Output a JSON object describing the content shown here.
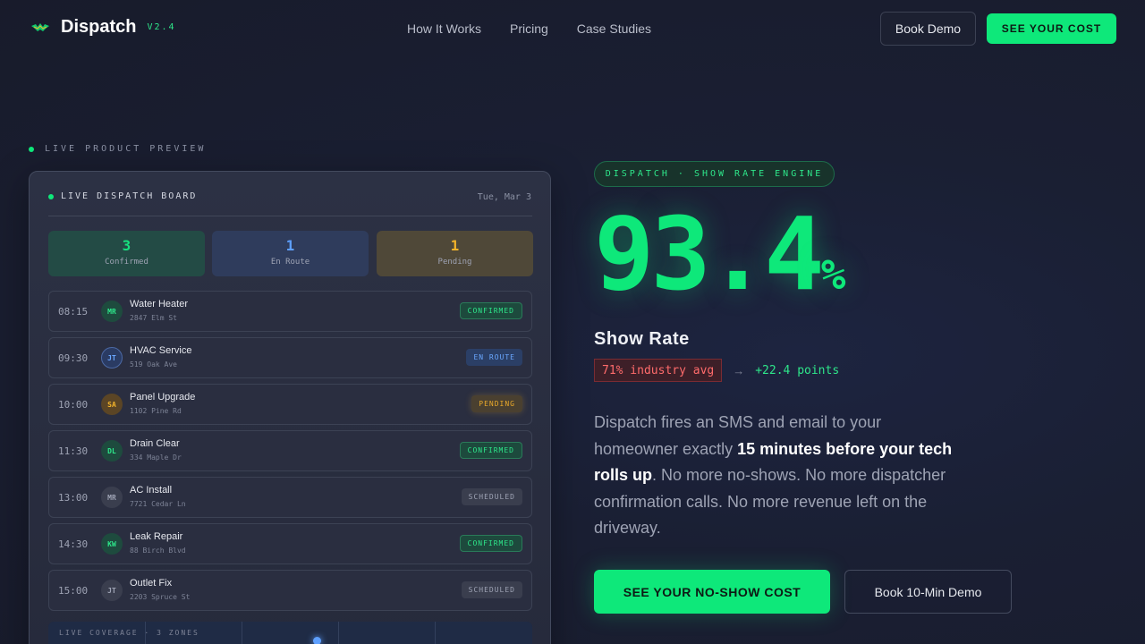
{
  "brand": {
    "name": "Dispatch",
    "version": "V2.4",
    "icon": "bat-logo-icon"
  },
  "nav": {
    "links": [
      "How It Works",
      "Pricing",
      "Case Studies"
    ],
    "book_demo": "Book Demo",
    "see_cost": "SEE YOUR COST"
  },
  "preview": {
    "label": "LIVE PRODUCT PREVIEW"
  },
  "board": {
    "title": "LIVE DISPATCH BOARD",
    "date": "Tue, Mar 3",
    "stats": [
      {
        "value": "3",
        "label": "Confirmed"
      },
      {
        "value": "1",
        "label": "En Route"
      },
      {
        "value": "1",
        "label": "Pending"
      }
    ],
    "jobs": [
      {
        "time": "08:15",
        "initials": "MR",
        "title": "Water Heater",
        "address": "2847 Elm St",
        "status": "CONFIRMED"
      },
      {
        "time": "09:30",
        "initials": "JT",
        "title": "HVAC Service",
        "address": "519 Oak Ave",
        "status": "EN ROUTE"
      },
      {
        "time": "10:00",
        "initials": "SA",
        "title": "Panel Upgrade",
        "address": "1102 Pine Rd",
        "status": "PENDING"
      },
      {
        "time": "11:30",
        "initials": "DL",
        "title": "Drain Clear",
        "address": "334 Maple Dr",
        "status": "CONFIRMED"
      },
      {
        "time": "13:00",
        "initials": "MR",
        "title": "AC Install",
        "address": "7721 Cedar Ln",
        "status": "SCHEDULED"
      },
      {
        "time": "14:30",
        "initials": "KW",
        "title": "Leak Repair",
        "address": "88 Birch Blvd",
        "status": "CONFIRMED"
      },
      {
        "time": "15:00",
        "initials": "JT",
        "title": "Outlet Fix",
        "address": "2203 Spruce St",
        "status": "SCHEDULED"
      }
    ],
    "coverage_label": "LIVE COVERAGE · 3 ZONES"
  },
  "hero": {
    "pill": "DISPATCH · SHOW RATE ENGINE",
    "rate_value": "93.4",
    "rate_unit": "%",
    "rate_label": "Show Rate",
    "industry": "71% industry avg",
    "arrow": "→",
    "gain": "+22.4 points",
    "desc_1": "Dispatch fires an SMS and email to your homeowner exactly ",
    "desc_bold": "15 minutes before your tech rolls up",
    "desc_2": ". No more no-shows. No more dispatcher confirmation calls. No more revenue left on the driveway.",
    "cta_primary": "SEE YOUR NO-SHOW COST",
    "cta_secondary": "Book 10-Min Demo"
  },
  "colors": {
    "accent": "#0ee87a",
    "blue": "#5ea0ff",
    "amber": "#f2b32a",
    "red": "#ff6b6b"
  }
}
